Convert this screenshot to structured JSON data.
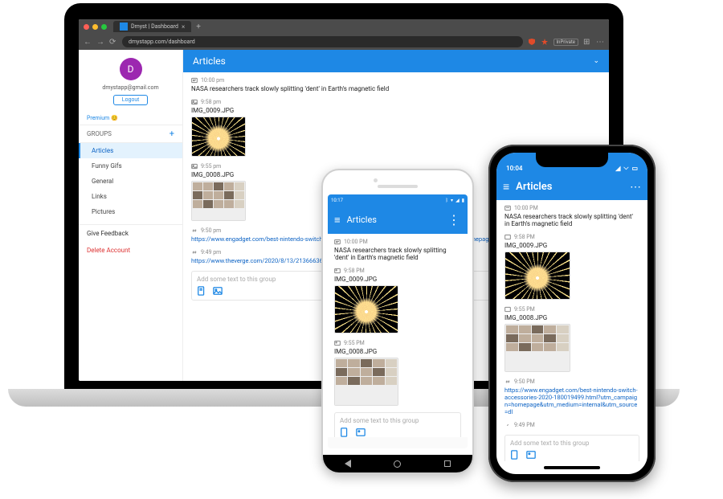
{
  "browser": {
    "tab_title": "Dmyst | Dashboard",
    "url": "dmystapp.com/dashboard",
    "inprivate": "InPrivate"
  },
  "sidebar": {
    "avatar_letter": "D",
    "email": "dmystapp@gmail.com",
    "logout": "Logout",
    "premium": "Premium 😊",
    "groups_label": "GROUPS",
    "items": [
      "Articles",
      "Funny Gifs",
      "General",
      "Links",
      "Pictures"
    ],
    "feedback": "Give Feedback",
    "delete": "Delete Account"
  },
  "panel": {
    "title": "Articles",
    "items": [
      {
        "time": "10:00 pm",
        "title": "NASA researchers track slowly splitting 'dent' in Earth's magnetic field",
        "kind": "text"
      },
      {
        "time": "9:58 pm",
        "title": "IMG_0009.JPG",
        "kind": "firework"
      },
      {
        "time": "9:55 pm",
        "title": "IMG_0008.JPG",
        "kind": "collage"
      },
      {
        "time": "9:50 pm",
        "title": "https://www.engadget.com/best-nintendo-switch-accessories-2020-180019499.html?utm_campaign=homepage&utm_medium=internal&utm_source=dl",
        "kind": "link"
      },
      {
        "time": "9:49 pm",
        "title": "https://www.theverge.com/2020/8/13/21366636/...",
        "kind": "link"
      }
    ],
    "composer": "Add some text to this group"
  },
  "android": {
    "status_time": "10:17",
    "title": "Articles",
    "items": [
      {
        "time": "10:00 PM",
        "title": "NASA researchers track slowly splitting 'dent' in Earth's magnetic field",
        "kind": "text"
      },
      {
        "time": "9:58 PM",
        "title": "IMG_0009.JPG",
        "kind": "firework"
      },
      {
        "time": "9:55 PM",
        "title": "IMG_0008.JPG",
        "kind": "collage"
      }
    ],
    "composer": "Add some text to this group"
  },
  "iphone": {
    "status_time": "10:04",
    "title": "Articles",
    "items": [
      {
        "time": "10:00 PM",
        "title": "NASA researchers track slowly splitting 'dent' in Earth's magnetic field",
        "kind": "text"
      },
      {
        "time": "9:58 PM",
        "title": "IMG_0009.JPG",
        "kind": "firework"
      },
      {
        "time": "9:55 PM",
        "title": "IMG_0008.JPG",
        "kind": "collage"
      },
      {
        "time": "9:50 PM",
        "title": "https://www.engadget.com/best-nintendo-switch-accessories-2020-180019499.html?utm_campaign=homepage&utm_medium=internal&utm_source=dl",
        "kind": "link"
      },
      {
        "time": "9:49 PM",
        "title": "",
        "kind": "text"
      }
    ],
    "composer": "Add some text to this group"
  }
}
